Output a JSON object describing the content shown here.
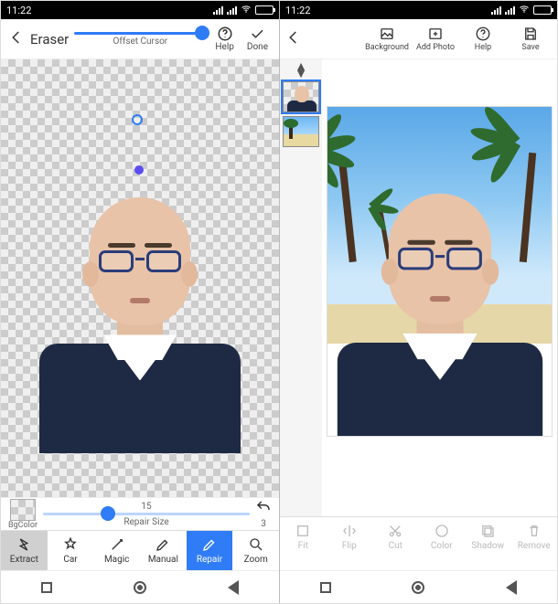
{
  "statusbar": {
    "time": "11:22",
    "extra_l": "& ⊡",
    "extra_r": "⊘ ⊡"
  },
  "left": {
    "title": "Eraser",
    "offset_cursor": {
      "label": "Offset Cursor",
      "value": 100
    },
    "toolbar": {
      "help_label": "Help",
      "done_label": "Done"
    },
    "repair": {
      "bgcolor_label": "BgColor",
      "size_label": "Repair Size",
      "size_value": "15",
      "undo_count": "3"
    },
    "tabs": [
      {
        "key": "extract",
        "label": "Extract"
      },
      {
        "key": "car",
        "label": "Car"
      },
      {
        "key": "magic",
        "label": "Magic"
      },
      {
        "key": "manual",
        "label": "Manual"
      },
      {
        "key": "repair",
        "label": "Repair"
      },
      {
        "key": "zoom",
        "label": "Zoom"
      }
    ]
  },
  "right": {
    "toolbar": {
      "background_label": "Background",
      "addphoto_label": "Add Photo",
      "help_label": "Help",
      "save_label": "Save"
    },
    "thumbs": [
      {
        "key": "cutout",
        "name": "subject-cutout-thumb"
      },
      {
        "key": "beach",
        "name": "beach-bg-thumb"
      }
    ],
    "tabs": [
      {
        "key": "fit",
        "label": "Fit"
      },
      {
        "key": "flip",
        "label": "Flip"
      },
      {
        "key": "cut",
        "label": "Cut"
      },
      {
        "key": "color",
        "label": "Color"
      },
      {
        "key": "shadow",
        "label": "Shadow"
      },
      {
        "key": "remove",
        "label": "Remove"
      }
    ]
  },
  "colors": {
    "accent": "#2f7cf6"
  }
}
